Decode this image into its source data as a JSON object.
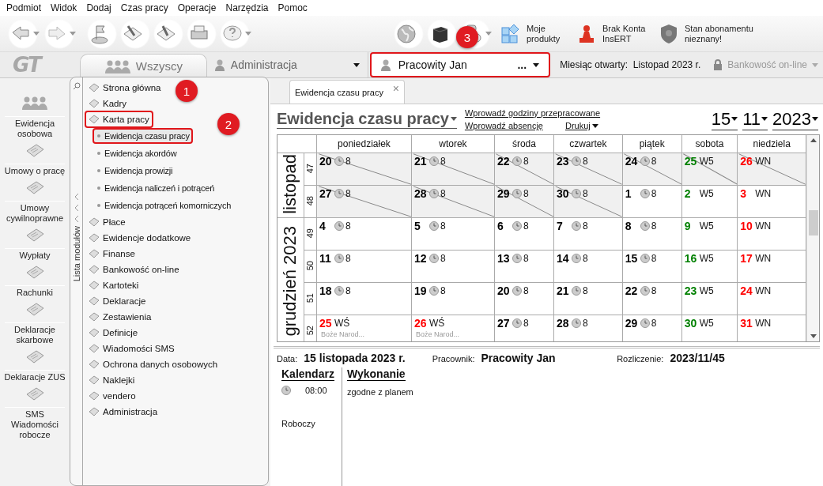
{
  "menu": [
    "Podmiot",
    "Widok",
    "Dodaj",
    "Czas pracy",
    "Operacje",
    "Narzędzia",
    "Pomoc"
  ],
  "toolbar_links": [
    {
      "label": "Moje produkty"
    },
    {
      "label": "Brak Konta InsERT"
    },
    {
      "label": "Stan abonamentu nieznany!"
    }
  ],
  "logo": "GT",
  "group_tab": {
    "label": "Wszyscy"
  },
  "group_select": {
    "value": "Administracja"
  },
  "employee_select": {
    "value": "Pracowity Jan",
    "more": "...",
    "highlighted": true
  },
  "open_month": {
    "label": "Miesiąc otwarty:",
    "value": "Listopad 2023 r."
  },
  "banking": {
    "label": "Bankowość on-line",
    "disabled": true
  },
  "sidebar": [
    {
      "label": "Ewidencja osobowa"
    },
    {
      "label": "Umowy o pracę"
    },
    {
      "label": "Umowy cywilnoprawne"
    },
    {
      "label": "Wypłaty"
    },
    {
      "label": "Rachunki"
    },
    {
      "label": "Deklaracje skarbowe"
    },
    {
      "label": "Deklaracje ZUS"
    },
    {
      "label": "SMS Wiadomości robocze"
    }
  ],
  "modules": {
    "side_label": "Lista modułów",
    "items": [
      {
        "label": "Strona główna",
        "highlighted": false
      },
      {
        "label": "Kadry",
        "highlighted": false
      },
      {
        "label": "Karta pracy",
        "highlighted": true,
        "children": [
          {
            "label": "Ewidencja czasu pracy",
            "selected": true,
            "highlighted": true
          },
          {
            "label": "Ewidencja akordów",
            "selected": false,
            "highlighted": false
          },
          {
            "label": "Ewidencja prowizji",
            "selected": false,
            "highlighted": false
          },
          {
            "label": "Ewidencja naliczeń i potrąceń",
            "selected": false,
            "highlighted": false
          },
          {
            "label": "Ewidencja potrąceń komorniczych",
            "selected": false,
            "highlighted": false
          }
        ]
      },
      {
        "label": "Płace",
        "highlighted": false
      },
      {
        "label": "Ewidencje dodatkowe",
        "highlighted": false
      },
      {
        "label": "Finanse",
        "highlighted": false
      },
      {
        "label": "Bankowość on-line",
        "highlighted": false
      },
      {
        "label": "Kartoteki",
        "highlighted": false
      },
      {
        "label": "Deklaracje",
        "highlighted": false
      },
      {
        "label": "Zestawienia",
        "highlighted": false
      },
      {
        "label": "Definicje",
        "highlighted": false
      },
      {
        "label": "Wiadomości SMS",
        "highlighted": false
      },
      {
        "label": "Ochrona danych osobowych",
        "highlighted": false
      },
      {
        "label": "Naklejki",
        "highlighted": false
      },
      {
        "label": "vendero",
        "highlighted": false
      },
      {
        "label": "Administracja",
        "highlighted": false
      }
    ]
  },
  "document_tab": {
    "label": "Ewidencja czasu pracy",
    "close": "×"
  },
  "header": {
    "title": "Ewidencja czasu pracy",
    "links": [
      "Wprowadź godziny przepracowane",
      "Wprowadź absencję"
    ],
    "print": "Drukuj",
    "date": [
      "15",
      "11",
      "2023"
    ]
  },
  "calendar": {
    "weekdays": [
      "poniedziałek",
      "wtorek",
      "środa",
      "czwartek",
      "piątek",
      "sobota",
      "niedziela"
    ],
    "months": [
      {
        "label": "listopad",
        "weeks": [
          {
            "week": "47",
            "days": [
              {
                "day": "20",
                "kind": "work",
                "hours": "8",
                "color": "#000000",
                "struck": true
              },
              {
                "day": "21",
                "kind": "work",
                "hours": "8",
                "color": "#000000",
                "struck": true
              },
              {
                "day": "22",
                "kind": "work",
                "hours": "8",
                "color": "#000000",
                "struck": true
              },
              {
                "day": "23",
                "kind": "work",
                "hours": "8",
                "color": "#000000",
                "struck": true
              },
              {
                "day": "24",
                "kind": "work",
                "hours": "8",
                "color": "#000000",
                "struck": true
              },
              {
                "day": "25",
                "kind": "free",
                "hours": "W5",
                "color": "#008000",
                "struck": true
              },
              {
                "day": "26",
                "kind": "free",
                "hours": "WN",
                "color": "#ff0000",
                "struck": true
              }
            ]
          },
          {
            "week": "48",
            "days": [
              {
                "day": "27",
                "kind": "work",
                "hours": "8",
                "color": "#000000",
                "struck": true
              },
              {
                "day": "28",
                "kind": "work",
                "hours": "8",
                "color": "#000000",
                "struck": true
              },
              {
                "day": "29",
                "kind": "work",
                "hours": "8",
                "color": "#000000",
                "struck": true
              },
              {
                "day": "30",
                "kind": "work",
                "hours": "8",
                "color": "#000000",
                "struck": true
              },
              {
                "day": "1",
                "kind": "work",
                "hours": "8",
                "color": "#000000",
                "struck": false
              },
              {
                "day": "2",
                "kind": "free",
                "hours": "W5",
                "color": "#008000",
                "struck": false
              },
              {
                "day": "3",
                "kind": "free",
                "hours": "WN",
                "color": "#ff0000",
                "struck": false
              }
            ]
          }
        ]
      },
      {
        "label": "grudzień 2023",
        "weeks": [
          {
            "week": "49",
            "days": [
              {
                "day": "4",
                "kind": "work",
                "hours": "8",
                "color": "#000000",
                "struck": false
              },
              {
                "day": "5",
                "kind": "work",
                "hours": "8",
                "color": "#000000",
                "struck": false
              },
              {
                "day": "6",
                "kind": "work",
                "hours": "8",
                "color": "#000000",
                "struck": false
              },
              {
                "day": "7",
                "kind": "work",
                "hours": "8",
                "color": "#000000",
                "struck": false
              },
              {
                "day": "8",
                "kind": "work",
                "hours": "8",
                "color": "#000000",
                "struck": false
              },
              {
                "day": "9",
                "kind": "free",
                "hours": "W5",
                "color": "#008000",
                "struck": false
              },
              {
                "day": "10",
                "kind": "free",
                "hours": "WN",
                "color": "#ff0000",
                "struck": false
              }
            ]
          },
          {
            "week": "50",
            "days": [
              {
                "day": "11",
                "kind": "work",
                "hours": "8",
                "color": "#000000",
                "struck": false
              },
              {
                "day": "12",
                "kind": "work",
                "hours": "8",
                "color": "#000000",
                "struck": false
              },
              {
                "day": "13",
                "kind": "work",
                "hours": "8",
                "color": "#000000",
                "struck": false
              },
              {
                "day": "14",
                "kind": "work",
                "hours": "8",
                "color": "#000000",
                "struck": false
              },
              {
                "day": "15",
                "kind": "work",
                "hours": "8",
                "color": "#000000",
                "struck": false
              },
              {
                "day": "16",
                "kind": "free",
                "hours": "W5",
                "color": "#008000",
                "struck": false
              },
              {
                "day": "17",
                "kind": "free",
                "hours": "WN",
                "color": "#ff0000",
                "struck": false
              }
            ]
          },
          {
            "week": "51",
            "days": [
              {
                "day": "18",
                "kind": "work",
                "hours": "8",
                "color": "#000000",
                "struck": false
              },
              {
                "day": "19",
                "kind": "work",
                "hours": "8",
                "color": "#000000",
                "struck": false
              },
              {
                "day": "20",
                "kind": "work",
                "hours": "8",
                "color": "#000000",
                "struck": false
              },
              {
                "day": "21",
                "kind": "work",
                "hours": "8",
                "color": "#000000",
                "struck": false
              },
              {
                "day": "22",
                "kind": "work",
                "hours": "8",
                "color": "#000000",
                "struck": false
              },
              {
                "day": "23",
                "kind": "free",
                "hours": "W5",
                "color": "#008000",
                "struck": false
              },
              {
                "day": "24",
                "kind": "free",
                "hours": "WN",
                "color": "#ff0000",
                "struck": false
              }
            ]
          },
          {
            "week": "52",
            "days": [
              {
                "day": "25",
                "kind": "free",
                "hours": "WŚ",
                "note": "Boże Narod...",
                "color": "#ff0000",
                "struck": false
              },
              {
                "day": "26",
                "kind": "free",
                "hours": "WŚ",
                "note": "Boże Narod...",
                "color": "#ff0000",
                "struck": false
              },
              {
                "day": "27",
                "kind": "work",
                "hours": "8",
                "color": "#000000",
                "struck": false
              },
              {
                "day": "28",
                "kind": "work",
                "hours": "8",
                "color": "#000000",
                "struck": false
              },
              {
                "day": "29",
                "kind": "work",
                "hours": "8",
                "color": "#000000",
                "struck": false
              },
              {
                "day": "30",
                "kind": "free",
                "hours": "W5",
                "color": "#008000",
                "struck": false
              },
              {
                "day": "31",
                "kind": "free",
                "hours": "WN",
                "color": "#ff0000",
                "struck": false
              }
            ]
          }
        ]
      }
    ]
  },
  "details": {
    "fields": [
      {
        "label": "Data:",
        "value": "15 listopada 2023 r."
      },
      {
        "label": "Pracownik:",
        "value": "Pracowity Jan"
      },
      {
        "label": "Rozliczenie:",
        "value": "2023/11/45"
      }
    ],
    "calendar_heading": "Kalendarz",
    "time": "08:00",
    "day_type": "Roboczy",
    "execution_heading": "Wykonanie",
    "execution": "zgodne z planem"
  },
  "annotations": [
    {
      "number": "1"
    },
    {
      "number": "2"
    },
    {
      "number": "3"
    }
  ]
}
